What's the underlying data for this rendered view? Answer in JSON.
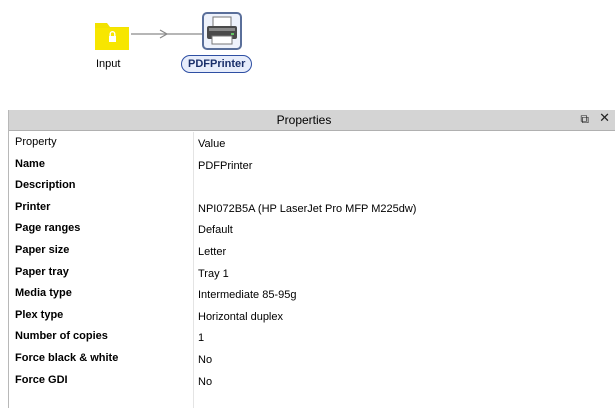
{
  "workflow": {
    "input_label": "Input",
    "printer_label": "PDFPrinter",
    "icons": [
      "folder-lock-icon",
      "printer-icon",
      "connector-arrow-icon"
    ]
  },
  "properties": {
    "title": "Properties",
    "float_icon": "⧉",
    "close_icon": "✕",
    "header": {
      "property": "Property",
      "value": "Value"
    },
    "rows": [
      {
        "key": "Name",
        "value": "PDFPrinter"
      },
      {
        "key": "Description",
        "value": ""
      },
      {
        "key": "Printer",
        "value": "NPI072B5A (HP LaserJet Pro MFP M225dw)"
      },
      {
        "key": "Page ranges",
        "value": "Default"
      },
      {
        "key": "Paper size",
        "value": "Letter"
      },
      {
        "key": "Paper tray",
        "value": " Tray 1"
      },
      {
        "key": "Media type",
        "value": "Intermediate 85-95g"
      },
      {
        "key": "Plex type",
        "value": "Horizontal duplex"
      },
      {
        "key": "Number of copies",
        "value": "1"
      },
      {
        "key": "Force black & white",
        "value": "No"
      },
      {
        "key": "Force GDI",
        "value": "No"
      }
    ]
  },
  "colors": {
    "folder": "#f2e200",
    "node_border": "#5a6f9a",
    "label_border": "#2e4fa3",
    "titlebar": "#d4d4d4"
  }
}
